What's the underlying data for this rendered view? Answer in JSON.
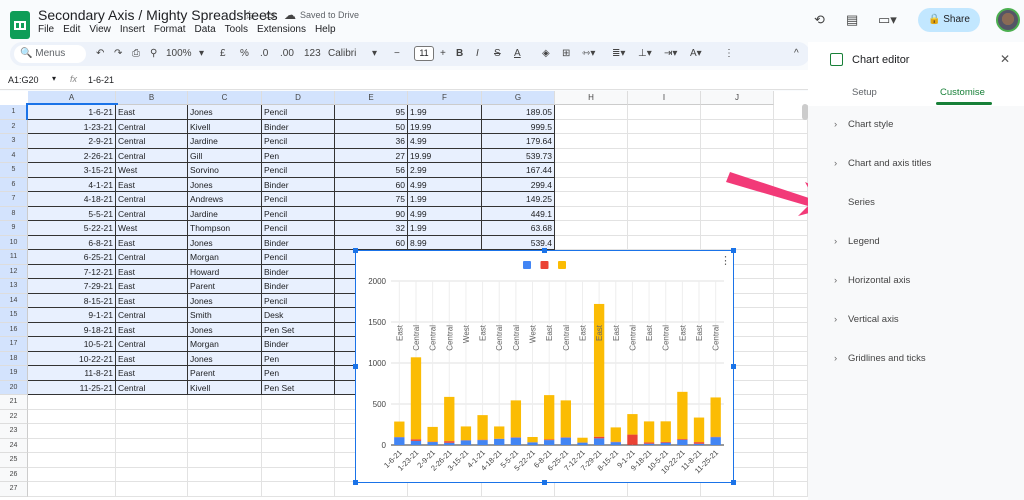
{
  "app": {
    "title": "Secondary Axis / Mighty Spreadsheets",
    "saved": "Saved to Drive",
    "share": "Share",
    "menus": [
      "File",
      "Edit",
      "View",
      "Insert",
      "Format",
      "Data",
      "Tools",
      "Extensions",
      "Help"
    ]
  },
  "toolbar": {
    "search": "Menus",
    "zoom": "100%",
    "currency": "£",
    "percent": "%",
    "dec_dec": ".0",
    "inc_dec": ".00",
    "format123": "123",
    "font": "Calibri",
    "font_size": "11",
    "bold": "B",
    "italic": "I"
  },
  "formula_bar": {
    "name_box": "A1:G20",
    "fx": "fx",
    "value": "1-6-21"
  },
  "columns": [
    "A",
    "B",
    "C",
    "D",
    "E",
    "F",
    "G",
    "H",
    "I",
    "J"
  ],
  "rows": [
    [
      "1-6-21",
      "East",
      "Jones",
      "Pencil",
      "95",
      "1.99",
      "189.05"
    ],
    [
      "1-23-21",
      "Central",
      "Kivell",
      "Binder",
      "50",
      "19.99",
      "999.5"
    ],
    [
      "2-9-21",
      "Central",
      "Jardine",
      "Pencil",
      "36",
      "4.99",
      "179.64"
    ],
    [
      "2-26-21",
      "Central",
      "Gill",
      "Pen",
      "27",
      "19.99",
      "539.73"
    ],
    [
      "3-15-21",
      "West",
      "Sorvino",
      "Pencil",
      "56",
      "2.99",
      "167.44"
    ],
    [
      "4-1-21",
      "East",
      "Jones",
      "Binder",
      "60",
      "4.99",
      "299.4"
    ],
    [
      "4-18-21",
      "Central",
      "Andrews",
      "Pencil",
      "75",
      "1.99",
      "149.25"
    ],
    [
      "5-5-21",
      "Central",
      "Jardine",
      "Pencil",
      "90",
      "4.99",
      "449.1"
    ],
    [
      "5-22-21",
      "West",
      "Thompson",
      "Pencil",
      "32",
      "1.99",
      "63.68"
    ],
    [
      "6-8-21",
      "East",
      "Jones",
      "Binder",
      "60",
      "8.99",
      "539.4"
    ],
    [
      "6-25-21",
      "Central",
      "Morgan",
      "Pencil",
      "",
      "",
      ""
    ],
    [
      "7-12-21",
      "East",
      "Howard",
      "Binder",
      "",
      "",
      ""
    ],
    [
      "7-29-21",
      "East",
      "Parent",
      "Binder",
      "",
      "",
      ""
    ],
    [
      "8-15-21",
      "East",
      "Jones",
      "Pencil",
      "",
      "",
      ""
    ],
    [
      "9-1-21",
      "Central",
      "Smith",
      "Desk",
      "",
      "",
      ""
    ],
    [
      "9-18-21",
      "East",
      "Jones",
      "Pen Set",
      "",
      "",
      ""
    ],
    [
      "10-5-21",
      "Central",
      "Morgan",
      "Binder",
      "",
      "",
      ""
    ],
    [
      "10-22-21",
      "East",
      "Jones",
      "Pen",
      "",
      "",
      ""
    ],
    [
      "11-8-21",
      "East",
      "Parent",
      "Pen",
      "",
      "",
      ""
    ],
    [
      "11-25-21",
      "Central",
      "Kivell",
      "Pen Set",
      "",
      "",
      ""
    ]
  ],
  "total_rows": 27,
  "chart_data": {
    "type": "bar",
    "stacked": true,
    "categories": [
      "1-6-21",
      "1-23-21",
      "2-9-21",
      "2-26-21",
      "3-15-21",
      "4-1-21",
      "4-18-21",
      "5-5-21",
      "5-22-21",
      "6-8-21",
      "6-25-21",
      "7-12-21",
      "7-29-21",
      "8-15-21",
      "9-1-21",
      "9-18-21",
      "10-5-21",
      "10-22-21",
      "11-8-21",
      "11-25-21"
    ],
    "annotations": [
      "East",
      "Central",
      "Central",
      "Central",
      "West",
      "East",
      "Central",
      "Central",
      "West",
      "East",
      "Central",
      "East",
      "East",
      "East",
      "Central",
      "East",
      "Central",
      "East",
      "East",
      "Central"
    ],
    "series": [
      {
        "color": "#4285f4",
        "values": [
          95,
          50,
          36,
          27,
          56,
          60,
          75,
          90,
          32,
          60,
          90,
          29,
          81,
          35,
          2,
          16,
          28,
          64,
          15,
          96
        ]
      },
      {
        "color": "#ea4335",
        "values": [
          1.99,
          19.99,
          4.99,
          19.99,
          2.99,
          4.99,
          1.99,
          4.99,
          1.99,
          8.99,
          4.99,
          1.99,
          19.99,
          4.99,
          125,
          15.99,
          8.99,
          8.99,
          19.99,
          4.99
        ]
      },
      {
        "color": "#fbbc04",
        "values": [
          189.05,
          999.5,
          179.64,
          539.73,
          167.44,
          299.4,
          149.25,
          449.1,
          63.68,
          539.4,
          449.1,
          57.71,
          1619.19,
          174.65,
          250,
          255.84,
          251.72,
          575.36,
          299.85,
          479.04
        ]
      }
    ],
    "yticks": [
      "0",
      "500",
      "1000",
      "1500",
      "2000"
    ],
    "ylim": [
      0,
      2000
    ],
    "grid": true,
    "legend": "top"
  },
  "editor": {
    "title": "Chart editor",
    "tabs": [
      "Setup",
      "Customise"
    ],
    "active_tab": "Customise",
    "sections": [
      "Chart style",
      "Chart and axis titles",
      "Series",
      "Legend",
      "Horizontal axis",
      "Vertical axis",
      "Gridlines and ticks"
    ]
  },
  "annotation_arrow_color": "#f23a78"
}
